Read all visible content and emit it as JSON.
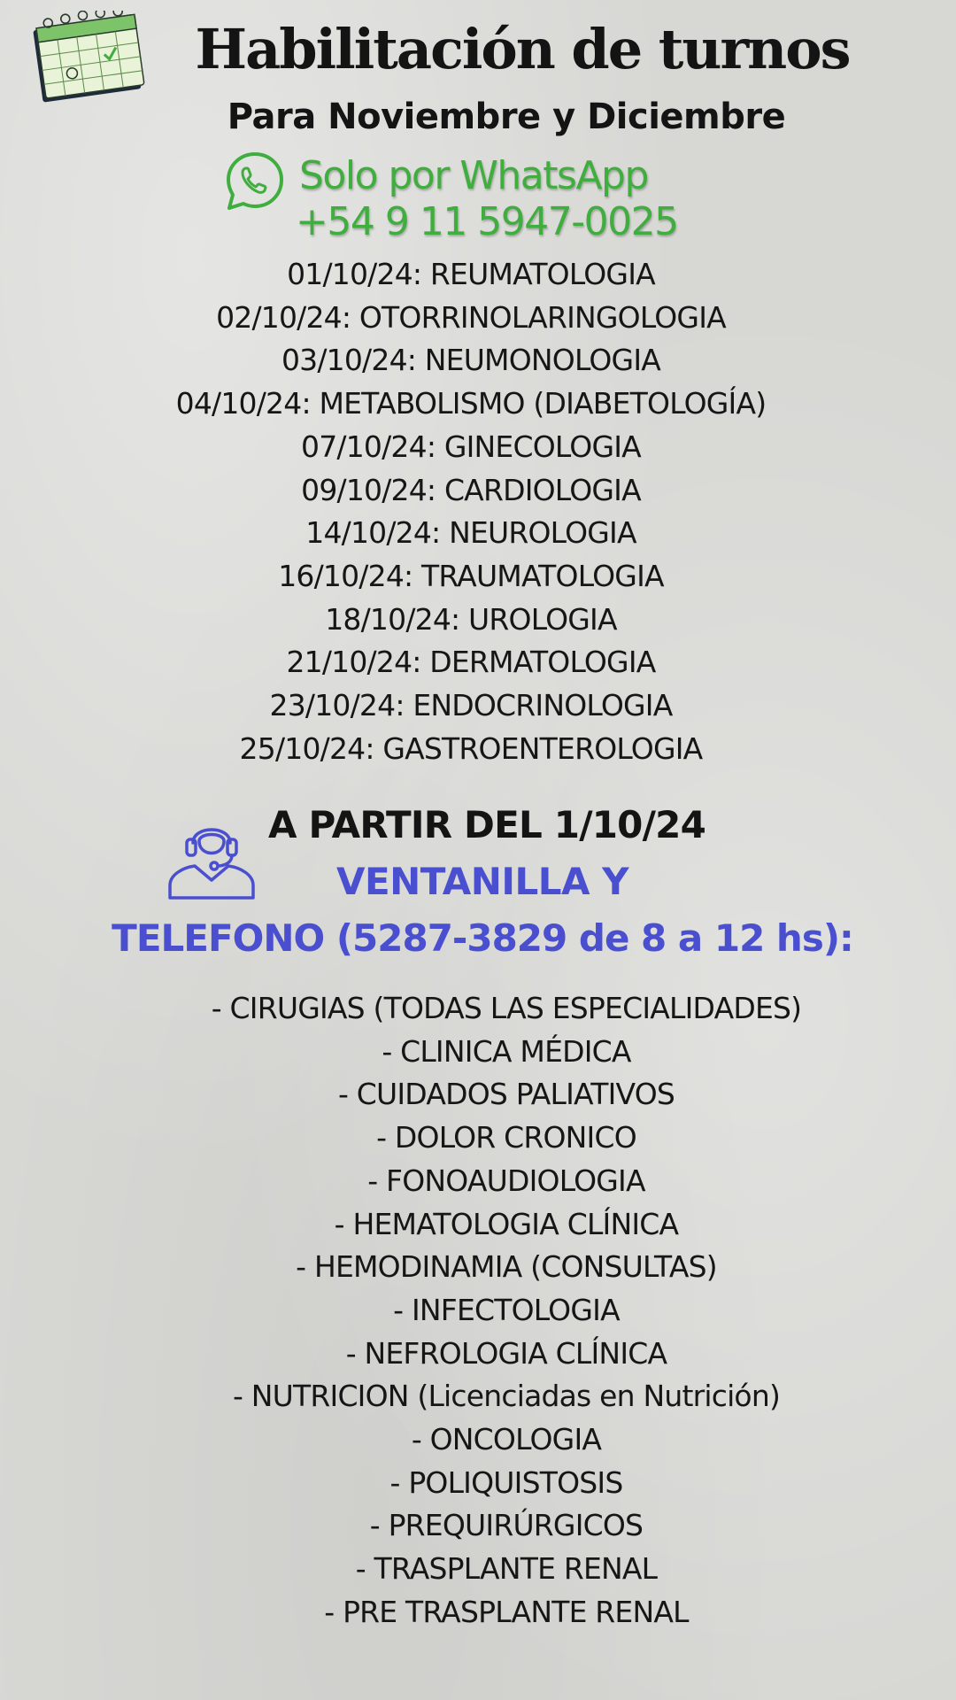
{
  "header": {
    "title": "Habilitación de turnos",
    "subtitle": "Para Noviembre y Diciembre",
    "calendar_icon": "calendar-icon"
  },
  "whatsapp": {
    "icon": "whatsapp-icon",
    "label": "Solo por WhatsApp",
    "phone": "+54 9 11 5947-0025",
    "color": "#3fae3f"
  },
  "schedule": [
    "01/10/24: REUMATOLOGIA",
    "02/10/24: OTORRINOLARINGOLOGIA",
    "03/10/24: NEUMONOLOGIA",
    "04/10/24: METABOLISMO (DIABETOLOGÍA)",
    "07/10/24: GINECOLOGIA",
    "09/10/24: CARDIOLOGIA",
    "14/10/24: NEUROLOGIA",
    "16/10/24: TRAUMATOLOGIA",
    "18/10/24: UROLOGIA",
    "21/10/24: DERMATOLOGIA",
    "23/10/24: ENDOCRINOLOGIA",
    "25/10/24: GASTROENTEROLOGIA"
  ],
  "window_section": {
    "icon": "headset-agent-icon",
    "from_date": "A PARTIR DEL 1/10/24",
    "window_label": "VENTANILLA Y",
    "phone_label": "TELEFONO (5287-3829 de 8 a 12 hs):",
    "accent_color": "#4a4fcf"
  },
  "services": [
    "- CIRUGIAS (TODAS LAS ESPECIALIDADES)",
    "- CLINICA MÉDICA",
    "- CUIDADOS PALIATIVOS",
    "- DOLOR CRONICO",
    "- FONOAUDIOLOGIA",
    "- HEMATOLOGIA CLÍNICA",
    "- HEMODINAMIA (CONSULTAS)",
    "- INFECTOLOGIA",
    "- NEFROLOGIA CLÍNICA",
    "- NUTRICION (Licenciadas en Nutrición)",
    "- ONCOLOGIA",
    "- POLIQUISTOSIS",
    "- PREQUIRÚRGICOS",
    "- TRASPLANTE RENAL",
    "- PRE TRASPLANTE RENAL"
  ]
}
